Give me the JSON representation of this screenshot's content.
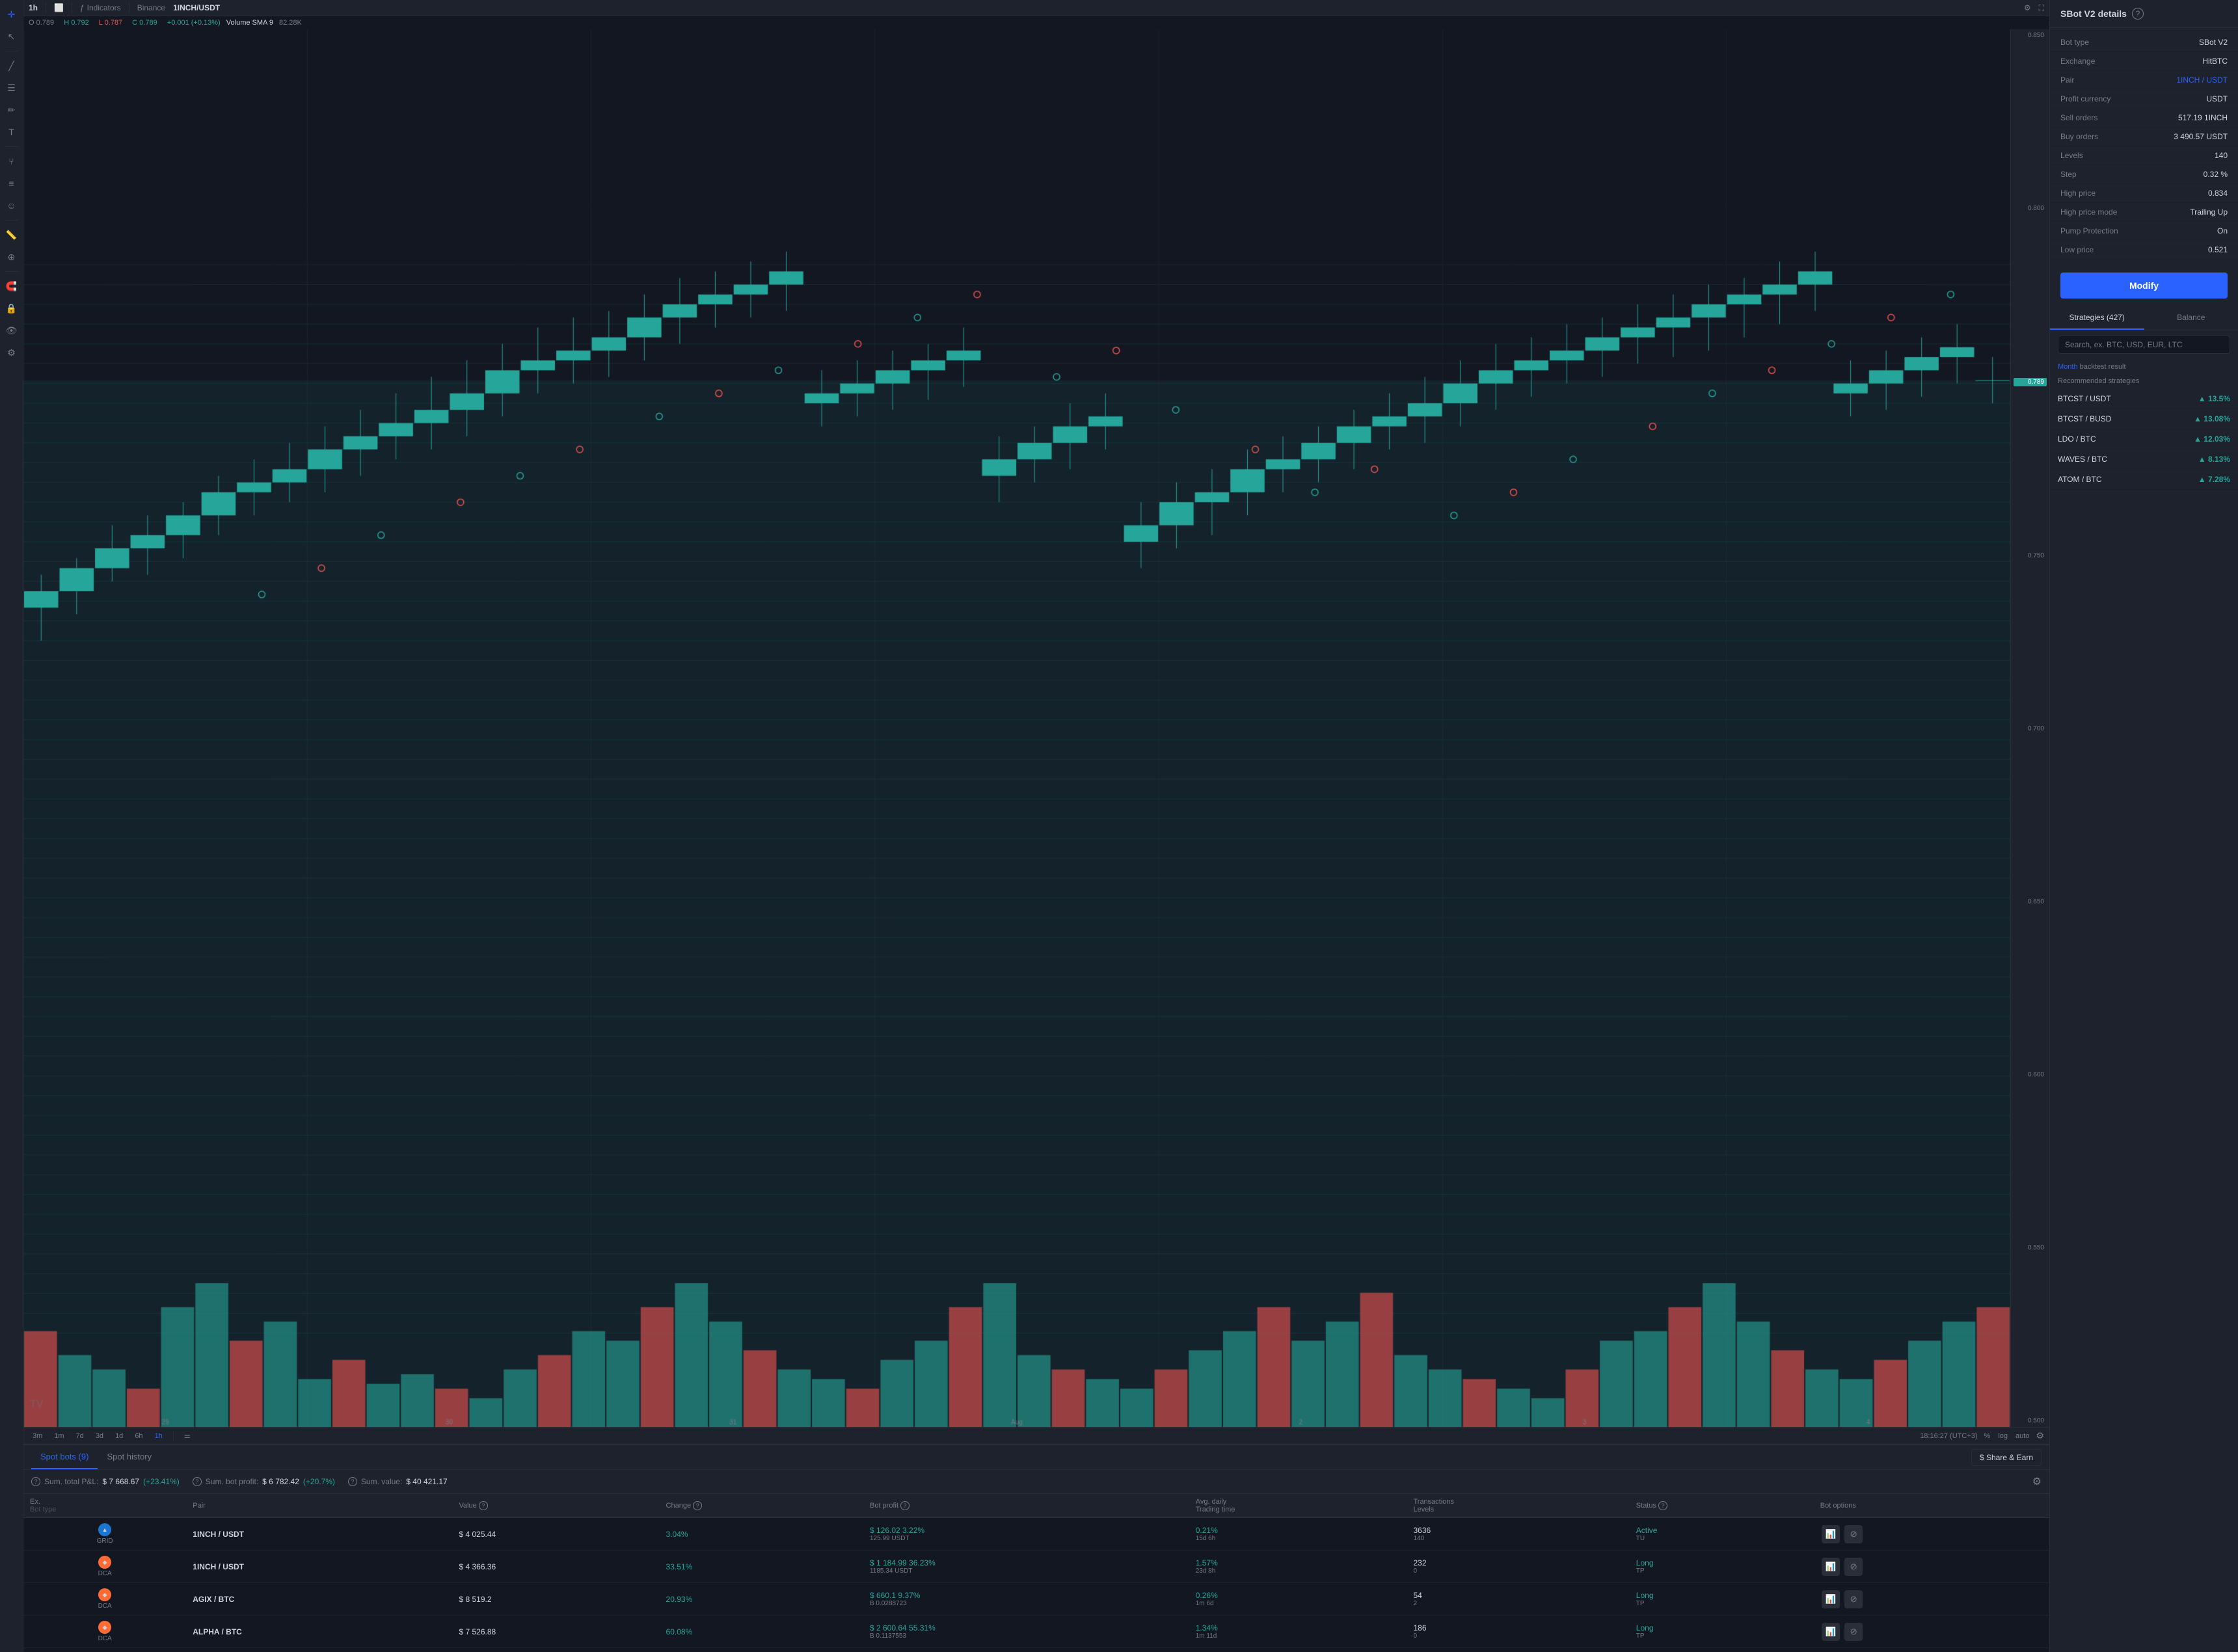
{
  "app": {
    "title": "SBot V2 details"
  },
  "chart_header": {
    "timeframe": "1h",
    "compare_icon": "⇄",
    "indicators_label": "Indicators",
    "exchange": "Binance",
    "pair": "1INCH/USDT",
    "gear_icon": "⚙",
    "fullscreen_icon": "⛶"
  },
  "ohlcv": {
    "o_label": "O",
    "o_val": "0.789",
    "h_label": "H",
    "h_val": "0.792",
    "l_label": "L",
    "l_val": "0.787",
    "c_label": "C",
    "c_val": "0.789",
    "change": "+0.001 (+0.13%)",
    "vol_label": "Volume SMA 9",
    "vol_val": "82.28K"
  },
  "timeframes": [
    "3m",
    "1m",
    "7d",
    "3d",
    "1d",
    "6h",
    "1h"
  ],
  "active_timeframe": "1h",
  "chart_time": "18:16:27 (UTC+3)",
  "chart_scale": {
    "pct": "%",
    "log": "log",
    "auto": "auto"
  },
  "price_scale": {
    "levels": [
      "0.850",
      "0.800",
      "0.750",
      "0.700",
      "0.650",
      "0.600",
      "0.550",
      "0.500"
    ],
    "current": "0.789"
  },
  "x_axis_labels": [
    "29",
    "30",
    "31",
    "Aug",
    "2",
    "3",
    "4"
  ],
  "sbot": {
    "title": "SBot V2 details",
    "help": "?",
    "bot_type_label": "Bot type",
    "bot_type_val": "SBot V2",
    "exchange_label": "Exchange",
    "exchange_val": "HitBTC",
    "pair_label": "Pair",
    "pair_val": "1INCH / USDT",
    "profit_currency_label": "Profit currency",
    "profit_currency_val": "USDT",
    "sell_orders_label": "Sell orders",
    "sell_orders_val": "517.19 1INCH",
    "buy_orders_label": "Buy orders",
    "buy_orders_val": "3 490.57 USDT",
    "levels_label": "Levels",
    "levels_val": "140",
    "step_label": "Step",
    "step_val": "0.32 %",
    "high_price_label": "High price",
    "high_price_val": "0.834",
    "high_price_mode_label": "High price mode",
    "high_price_mode_val": "Trailing Up",
    "pump_protection_label": "Pump Protection",
    "pump_protection_val": "On",
    "low_price_label": "Low price",
    "low_price_val": "0.521",
    "modify_btn": "Modify"
  },
  "strategies": {
    "tab1": "Strategies (427)",
    "tab2": "Balance",
    "search_placeholder": "Search, ex. BTC, USD, EUR, LTC",
    "backtest_month": "Month",
    "backtest_label": "backtest result",
    "recommended_label": "Recommended strategies",
    "items": [
      {
        "name": "BTCST / USDT",
        "return": "13.5%"
      },
      {
        "name": "BTCST / BUSD",
        "return": "13.08%"
      },
      {
        "name": "LDO / BTC",
        "return": "12.03%"
      },
      {
        "name": "WAVES / BTC",
        "return": "8.13%"
      },
      {
        "name": "ATOM / BTC",
        "return": "7.28%"
      }
    ]
  },
  "tabs": {
    "tab1": "Spot bots (9)",
    "tab2": "Spot history",
    "share_earn": "$ Share & Earn"
  },
  "bots_summary": {
    "pnl_label": "Sum. total P&L:",
    "pnl_val": "$ 7 668.67",
    "pnl_pct": "(+23.41%)",
    "profit_label": "Sum. bot profit:",
    "profit_val": "$ 6 782.42",
    "profit_pct": "(+20.7%)",
    "value_label": "Sum. value:",
    "value_val": "$ 40 421.17"
  },
  "table_headers": {
    "ex": "Ex.",
    "pair": "Pair\nBot type",
    "value": "Value",
    "change": "Change",
    "bot_profit": "Bot profit",
    "avg_daily": "Avg. daily\nTrading time",
    "transactions": "Transactions\nLevels",
    "status": "Status",
    "bot_options": "Bot options"
  },
  "bots": [
    {
      "exchange_icon": "▲",
      "exchange_color": "#1976d2",
      "pair": "1INCH / USDT",
      "bot_type": "GRID",
      "value": "$ 4 025.44",
      "change": "3.04%",
      "change_color": "positive",
      "profit": "$ 126.02",
      "profit_pct": "3.22%",
      "profit_sub": "125.99 USDT",
      "avg_daily": "0.21%",
      "trading_time": "15d 6h",
      "transactions": "3636",
      "levels": "140",
      "status": "Active",
      "status_sub": "TU",
      "status_color": "active"
    },
    {
      "exchange_icon": "◆",
      "exchange_color": "#ff6b35",
      "pair": "1INCH / USDT",
      "bot_type": "DCA",
      "value": "$ 4 366.36",
      "change": "33.51%",
      "change_color": "positive",
      "profit": "$ 1 184.99",
      "profit_pct": "36.23%",
      "profit_sub": "1185.34 USDT",
      "avg_daily": "1.57%",
      "trading_time": "23d 8h",
      "transactions": "232",
      "levels": "0",
      "status": "Long",
      "status_sub": "TP",
      "status_color": "active"
    },
    {
      "exchange_icon": "◆",
      "exchange_color": "#ff6b35",
      "pair": "AGIX / BTC",
      "bot_type": "DCA",
      "value": "$ 8 519.2",
      "change": "20.93%",
      "change_color": "positive",
      "profit": "$ 660.1",
      "profit_pct": "9.37%",
      "profit_sub": "B 0.0288723",
      "avg_daily": "0.26%",
      "trading_time": "1m 6d",
      "transactions": "54",
      "levels": "2",
      "status": "Long",
      "status_sub": "TP",
      "status_color": "active"
    },
    {
      "exchange_icon": "◆",
      "exchange_color": "#ff6b35",
      "pair": "ALPHA / BTC",
      "bot_type": "DCA",
      "value": "$ 7 526.88",
      "change": "60.08%",
      "change_color": "positive",
      "profit": "$ 2 600.64",
      "profit_pct": "55.31%",
      "profit_sub": "B 0.1137553",
      "avg_daily": "1.34%",
      "trading_time": "1m 11d",
      "transactions": "186",
      "levels": "0",
      "status": "Long",
      "status_sub": "TP",
      "status_color": "active"
    }
  ]
}
